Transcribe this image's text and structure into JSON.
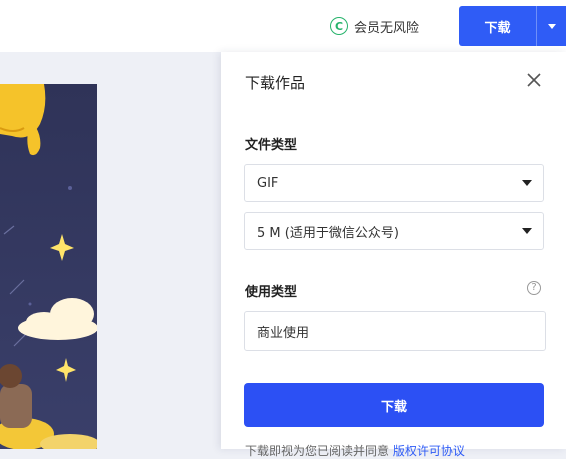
{
  "topbar": {
    "vip_icon_text": "C",
    "vip_label": "会员无风险",
    "download_label": "下载"
  },
  "panel": {
    "title": "下载作品",
    "file_type_label": "文件类型",
    "format_value": "GIF",
    "size_value": "5 M (适用于微信公众号)",
    "usage_type_label": "使用类型",
    "usage_value": "商业使用",
    "download_button": "下载",
    "note_text": "下载即视为您已阅读并同意",
    "note_link": "版权许可协议"
  },
  "colors": {
    "primary": "#2c50f4",
    "vip_green": "#26b36b",
    "artwork_sky": "#34385f"
  },
  "icons": [
    "copyright-icon",
    "chevron-down-icon",
    "close-icon",
    "help-icon",
    "caret-down-icon"
  ]
}
